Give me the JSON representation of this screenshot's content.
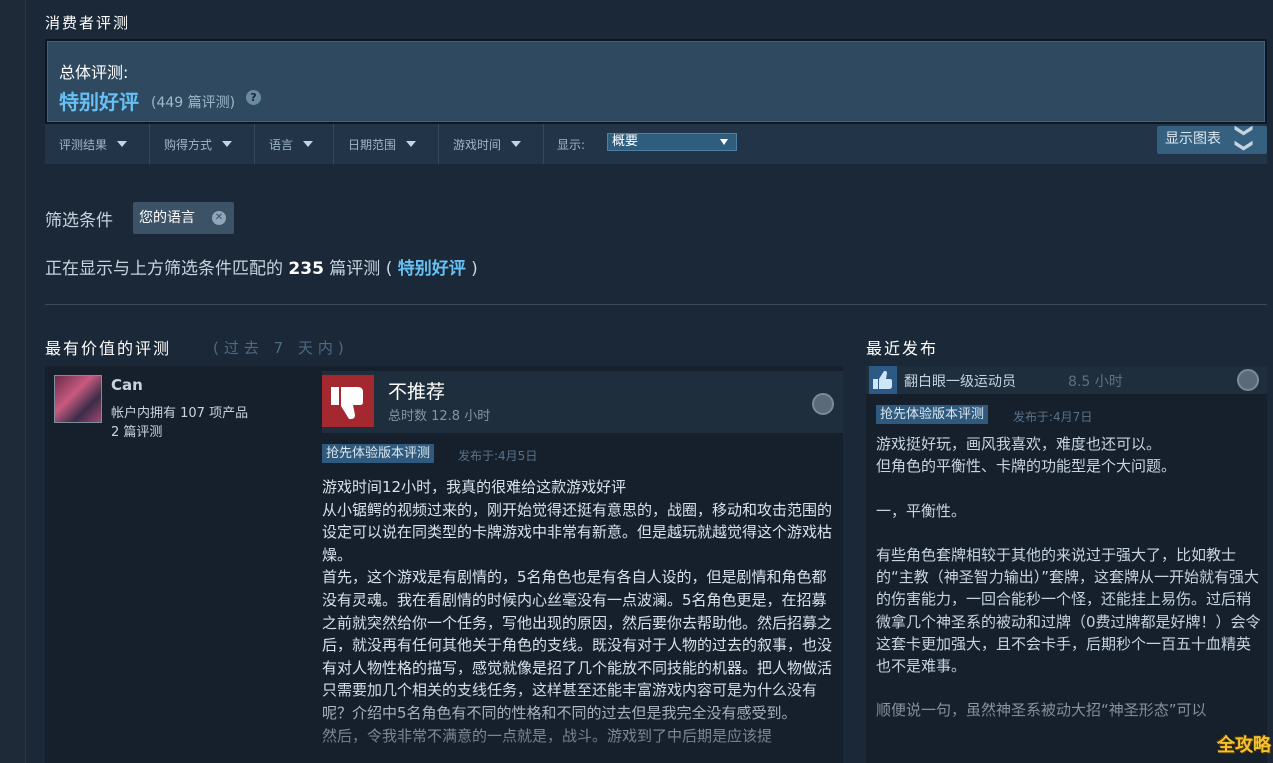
{
  "section_title": "消费者评测",
  "summary": {
    "label": "总体评测:",
    "rating": "特别好评",
    "count": "(449 篇评测)",
    "help_glyph": "?"
  },
  "filters": [
    {
      "label": "评测结果"
    },
    {
      "label": "购得方式"
    },
    {
      "label": "语言"
    },
    {
      "label": "日期范围"
    },
    {
      "label": "游戏时间"
    }
  ],
  "display": {
    "label": "显示:",
    "value": "概要"
  },
  "graph_button": {
    "label": "显示图表",
    "chevron": "❯❯"
  },
  "active_filters": {
    "label": "筛选条件",
    "tag": "您的语言",
    "remove_glyph": "✕"
  },
  "showing": {
    "prefix": "正在显示与上方筛选条件匹配的 ",
    "count": "235",
    "mid": " 篇评测 ( ",
    "rating": "特别好评",
    "suffix": " )"
  },
  "most_helpful": {
    "title": "最有价值的评测",
    "period": "(过去 7 天内)"
  },
  "recent": {
    "title": "最近发布"
  },
  "review": {
    "reviewer": "Can",
    "products": "帐户内拥有 107 项产品",
    "reviews": "2 篇评测",
    "verdict": "不推荐",
    "hours": "总时数 12.8 小时",
    "tag": "抢先体验版本评测",
    "posted": "发布于:4月5日",
    "body": "游戏时间12小时，我真的很难给这款游戏好评\n从小锯鳄的视频过来的，刚开始觉得还挺有意思的，战圈，移动和攻击范围的设定可以说在同类型的卡牌游戏中非常有新意。但是越玩就越觉得这个游戏枯燥。\n首先，这个游戏是有剧情的，5名角色也是有各自人设的，但是剧情和角色都没有灵魂。我在看剧情的时候内心丝毫没有一点波澜。5名角色更是，在招募之前就突然给你一个任务，写他出现的原因，然后要你去帮助他。然后招募之后，就没再有任何其他关于角色的支线。既没有对于人物的过去的叙事，也没有对人物性格的描写，感觉就像是招了几个能放不同技能的机器。把人物做活只需要加几个相关的支线任务，这样甚至还能丰富游戏内容可是为什么没有呢？介绍中5名角色有不同的性格和不同的过去但是我完全没有感受到。\n然后，令我非常不满意的一点就是，战斗。游戏到了中后期是应该提"
  },
  "recent_review": {
    "reviewer": "翻白眼一级运动员",
    "hours": "8.5 小时",
    "tag": "抢先体验版本评测",
    "posted": "发布于:4月7日",
    "body": "游戏挺好玩，画风我喜欢，难度也还可以。\n但角色的平衡性、卡牌的功能型是个大问题。\n\n一，平衡性。\n\n有些角色套牌相较于其他的来说过于强大了，比如教士的“主教（神圣智力输出）”套牌，这套牌从一开始就有强大的伤害能力，一回合能秒一个怪，还能挂上易伤。过后稍微拿几个神圣系的被动和过牌（0费过牌都是好牌！）会令这套卡更加强大，且不会卡手，后期秒个一百五十血精英也不是难事。\n\n顺便说一句，虽然神圣系被动大招“神圣形态”可以"
  },
  "watermark": "全攻略",
  "colors": {
    "background": "#1b2838",
    "accent_blue": "#66c0f4",
    "negative_red": "#a3282f",
    "tag_blue": "#2f5a7d"
  }
}
